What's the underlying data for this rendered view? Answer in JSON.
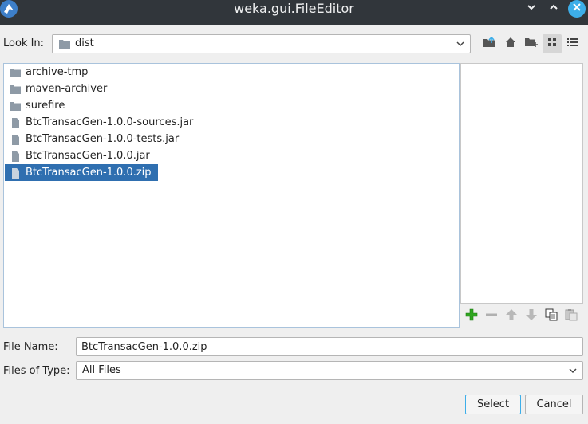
{
  "window": {
    "title": "weka.gui.FileEditor",
    "minimize_icon": "minimize-icon",
    "maximize_icon": "maximize-icon",
    "close_icon": "close-icon"
  },
  "look_in": {
    "label": "Look In:",
    "value": "dist"
  },
  "toolbar": {
    "icons": [
      "up-folder-icon",
      "home-icon",
      "new-folder-icon",
      "list-view-icon",
      "details-view-icon"
    ],
    "active": "list-view-icon"
  },
  "files": [
    {
      "name": "archive-tmp",
      "type": "folder"
    },
    {
      "name": "maven-archiver",
      "type": "folder"
    },
    {
      "name": "surefire",
      "type": "folder"
    },
    {
      "name": "BtcTransacGen-1.0.0-sources.jar",
      "type": "file"
    },
    {
      "name": "BtcTransacGen-1.0.0-tests.jar",
      "type": "file"
    },
    {
      "name": "BtcTransacGen-1.0.0.jar",
      "type": "file"
    },
    {
      "name": "BtcTransacGen-1.0.0.zip",
      "type": "file",
      "selected": true
    }
  ],
  "preview_toolbar": {
    "icons": [
      "add-icon",
      "remove-icon",
      "move-up-icon",
      "move-down-icon",
      "copy-icon",
      "paste-icon"
    ]
  },
  "file_name": {
    "label": "File Name:",
    "value": "BtcTransacGen-1.0.0.zip"
  },
  "file_type": {
    "label": "Files of Type:",
    "value": "All Files"
  },
  "buttons": {
    "select": "Select",
    "cancel": "Cancel"
  },
  "colors": {
    "titlebar": "#31363b",
    "selection": "#2f6fb0",
    "accent": "#3daee9",
    "add_green": "#2fa51f"
  }
}
